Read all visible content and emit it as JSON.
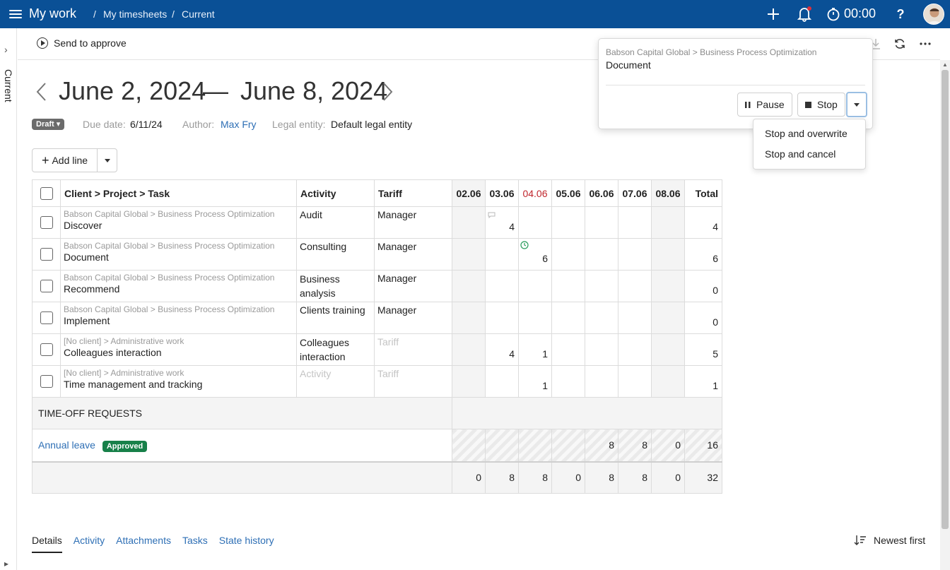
{
  "topbar": {
    "title": "My work",
    "breadcrumb": [
      "My timesheets",
      "Current"
    ],
    "timer": "00:00",
    "help": "?"
  },
  "sidebar": {
    "label": "Current"
  },
  "toolbar": {
    "send_label": "Send to approve"
  },
  "period": {
    "start": "June 2, 2024",
    "dash": "—",
    "end": "June 8, 2024"
  },
  "meta": {
    "status": "Draft",
    "due_label": "Due date:",
    "due_value": "6/11/24",
    "author_label": "Author:",
    "author_value": "Max Fry",
    "entity_label": "Legal entity:",
    "entity_value": "Default legal entity"
  },
  "add_line_label": "Add line",
  "table": {
    "headers": {
      "task": "Client > Project > Task",
      "activity": "Activity",
      "tariff": "Tariff",
      "days": [
        "02.06",
        "03.06",
        "04.06",
        "05.06",
        "06.06",
        "07.06",
        "08.06"
      ],
      "total": "Total"
    },
    "rows": [
      {
        "path": "Babson Capital Global > Business Process Optimization",
        "task": "Discover",
        "activity": "Audit",
        "tariff": "Manager",
        "cells": [
          "",
          "4",
          "",
          "",
          "",
          "",
          ""
        ],
        "total": "4"
      },
      {
        "path": "Babson Capital Global > Business Process Optimization",
        "task": "Document",
        "activity": "Consulting",
        "tariff": "Manager",
        "cells": [
          "",
          "",
          "6",
          "",
          "",
          "",
          ""
        ],
        "total": "6"
      },
      {
        "path": "Babson Capital Global > Business Process Optimization",
        "task": "Recommend",
        "activity": "Business analysis",
        "tariff": "Manager",
        "cells": [
          "",
          "",
          "",
          "",
          "",
          "",
          ""
        ],
        "total": "0"
      },
      {
        "path": "Babson Capital Global > Business Process Optimization",
        "task": "Implement",
        "activity": "Clients training",
        "tariff": "Manager",
        "cells": [
          "",
          "",
          "",
          "",
          "",
          "",
          ""
        ],
        "total": "0"
      },
      {
        "path": "[No client] > Administrative work",
        "task": "Colleagues interaction",
        "activity": "Colleagues interaction",
        "tariff": "Tariff",
        "cells": [
          "",
          "4",
          "1",
          "",
          "",
          "",
          ""
        ],
        "total": "5"
      },
      {
        "path": "[No client] > Administrative work",
        "task": "Time management and tracking",
        "activity": "Activity",
        "tariff": "Tariff",
        "cells": [
          "",
          "",
          "1",
          "",
          "",
          "",
          ""
        ],
        "total": "1"
      }
    ],
    "timeoff_header": "TIME-OFF REQUESTS",
    "timeoff": {
      "label": "Annual leave",
      "status": "Approved",
      "cells": [
        "",
        "",
        "",
        "",
        "8",
        "8",
        "0"
      ],
      "total": "16"
    },
    "totals": [
      "0",
      "8",
      "8",
      "0",
      "8",
      "8",
      "0"
    ],
    "grand_total": "32"
  },
  "popover": {
    "path": "Babson Capital Global > Business Process Optimization",
    "task": "Document",
    "pause_label": "Pause",
    "stop_label": "Stop",
    "menu": [
      "Stop and overwrite",
      "Stop and cancel"
    ]
  },
  "tabs": [
    "Details",
    "Activity",
    "Attachments",
    "Tasks",
    "State history"
  ],
  "sort_label": "Newest first"
}
